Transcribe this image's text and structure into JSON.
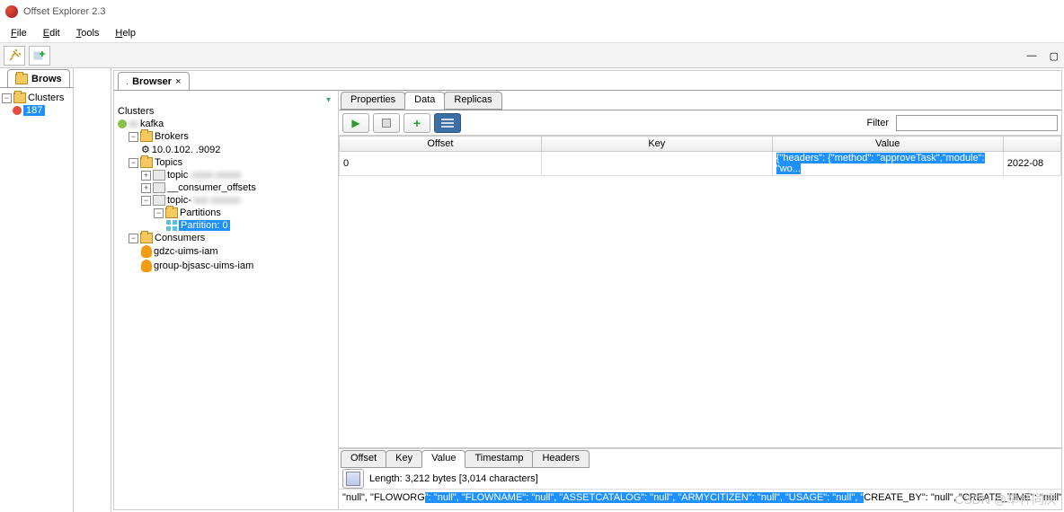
{
  "app": {
    "title": "Offset Explorer  2.3"
  },
  "menubar": {
    "file": "File",
    "edit": "Edit",
    "tools": "Tools",
    "help": "Help"
  },
  "left_browser_tab": "Brows",
  "left_tree": {
    "clusters": "Clusters",
    "cluster_badge": "187"
  },
  "inner_browser_tab": "Browser",
  "tree": {
    "root": "Clusters",
    "cluster": "kafka",
    "brokers": "Brokers",
    "broker_ip": "10.0.102.     .9092",
    "topics": "Topics",
    "topic1": "topic",
    "topic2": "__consumer_offsets",
    "topic3": "topic-",
    "partitions": "Partitions",
    "partition0": "Partition: 0",
    "consumers": "Consumers",
    "consumer1": "gdzc-uims-iam",
    "consumer2": "group-bjsasc-uims-iam"
  },
  "prop_tabs": {
    "properties": "Properties",
    "data": "Data",
    "replicas": "Replicas"
  },
  "data_toolbar": {
    "filter": "Filter"
  },
  "table": {
    "cols": {
      "offset": "Offset",
      "key": "Key",
      "value": "Value"
    },
    "row": {
      "offset": "0",
      "key": "",
      "value_hilit": "{\"headers\": {\"method\": \"approveTask\",\"module\": \"wo...",
      "ts": "2022-08"
    }
  },
  "detail_tabs": {
    "offset": "Offset",
    "key": "Key",
    "value": "Value",
    "timestamp": "Timestamp",
    "headers": "Headers"
  },
  "detail_toolbar": {
    "length": "Length: 3,212 bytes [3,014 characters]"
  },
  "detail_value": {
    "p1": "\"null\", \"FLOWORG",
    "p2": "\": \"null\", \"FLOWNAME\": \"null\", \"ASSETCATALOG\": \"null\", \"ARMYCITIZEN\": \"null\", \"USAGE\": \"null\", \"",
    "p3": "CREATE_BY\": \"null\", \"CREATE_TIME\": \"null\", \"UPDATE"
  },
  "watermark": "CSDN @举杯同庆"
}
